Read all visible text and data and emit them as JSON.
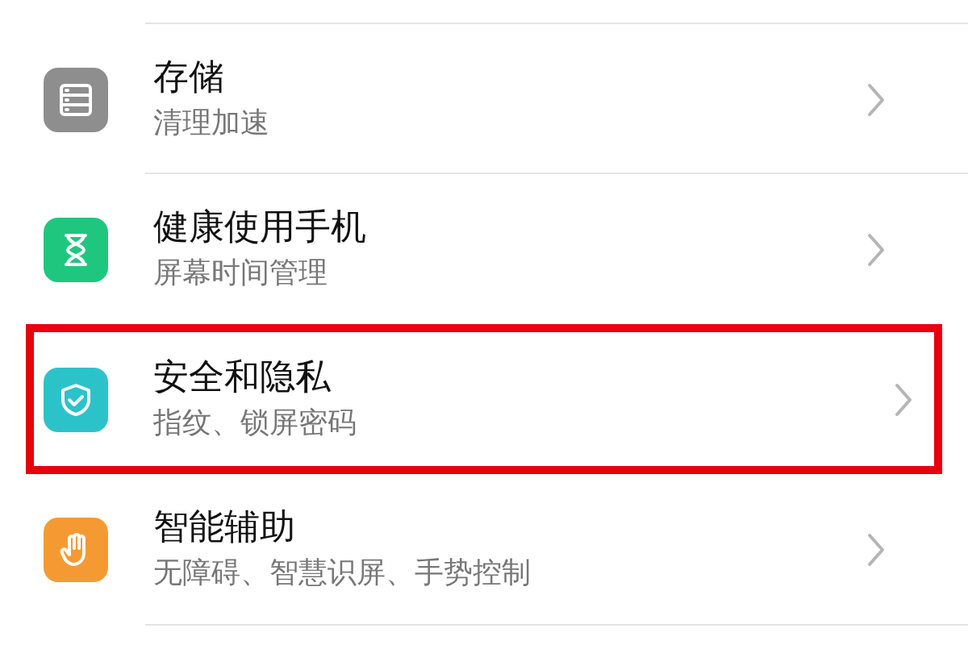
{
  "settings_items": [
    {
      "kind": "storage",
      "color": "#8e8e8e",
      "title": "存储",
      "subtitle": "清理加速",
      "selected": false
    },
    {
      "kind": "hourglass",
      "color": "#1fc77e",
      "title": "健康使用手机",
      "subtitle": "屏幕时间管理",
      "selected": false
    },
    {
      "kind": "shield",
      "color": "#2bc3c9",
      "title": "安全和隐私",
      "subtitle": "指纹、锁屏密码",
      "selected": true
    },
    {
      "kind": "hand",
      "color": "#f59a32",
      "title": "智能辅助",
      "subtitle": "无障碍、智慧识屏、手势控制",
      "selected": false
    }
  ]
}
